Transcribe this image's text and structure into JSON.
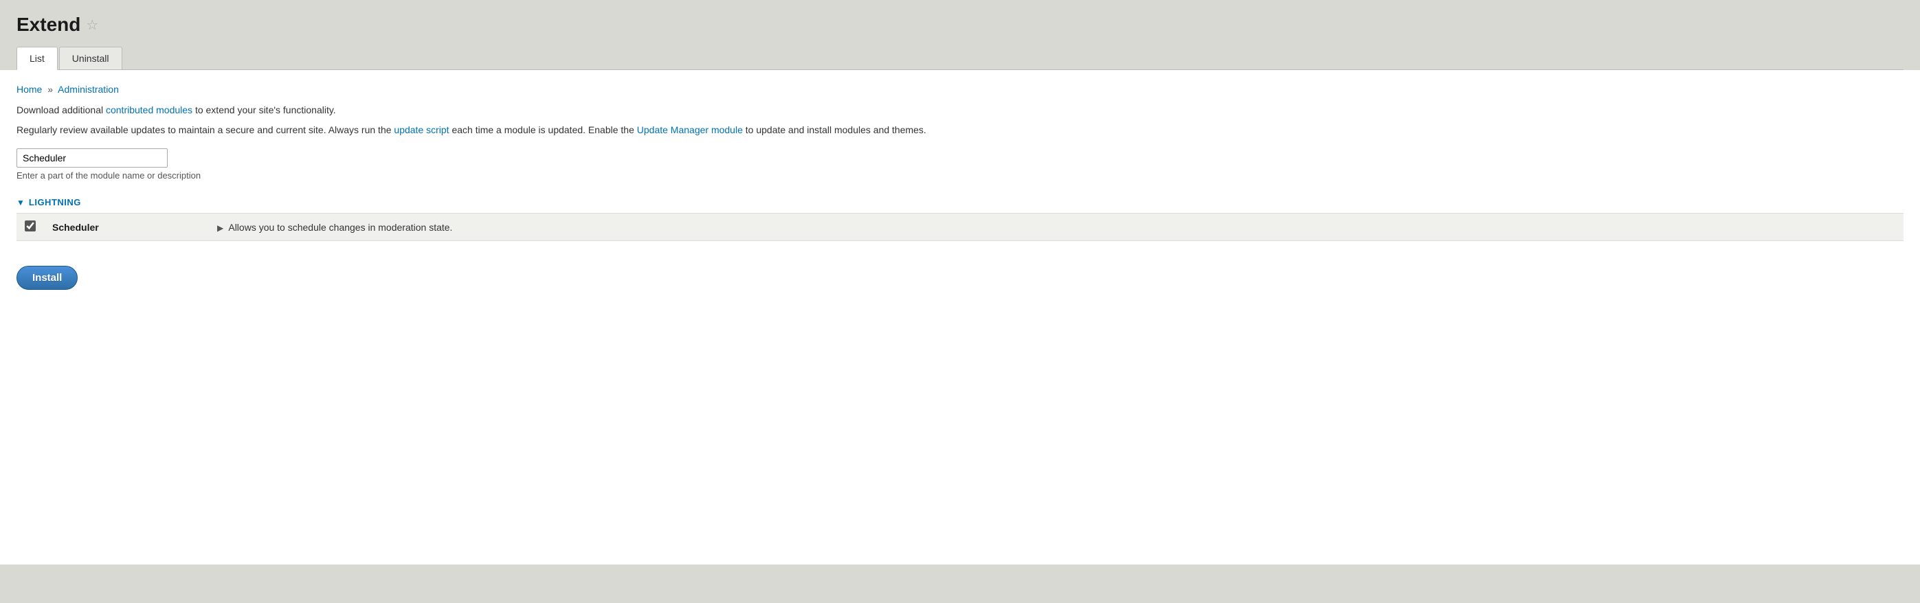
{
  "page": {
    "title": "Extend",
    "star_icon": "☆"
  },
  "tabs": [
    {
      "label": "List",
      "active": true
    },
    {
      "label": "Uninstall",
      "active": false
    }
  ],
  "breadcrumb": {
    "home": "Home",
    "separator": "»",
    "current": "Administration"
  },
  "descriptions": {
    "line1_prefix": "Download additional ",
    "line1_link": "contributed modules",
    "line1_suffix": " to extend your site's functionality.",
    "line2_prefix": "Regularly review available updates to maintain a secure and current site. Always run the ",
    "line2_link1": "update script",
    "line2_middle": " each time a module is updated. Enable the ",
    "line2_link2": "Update Manager module",
    "line2_suffix": " to update and install modules and themes."
  },
  "filter": {
    "value": "Scheduler",
    "placeholder": "Scheduler",
    "hint": "Enter a part of the module name or description"
  },
  "section": {
    "toggle": "▼",
    "title": "LIGHTNING"
  },
  "modules": [
    {
      "name": "Scheduler",
      "description": "Allows you to schedule changes in moderation state.",
      "checked": true,
      "toggle_arrow": "▶"
    }
  ],
  "install_button": "Install"
}
